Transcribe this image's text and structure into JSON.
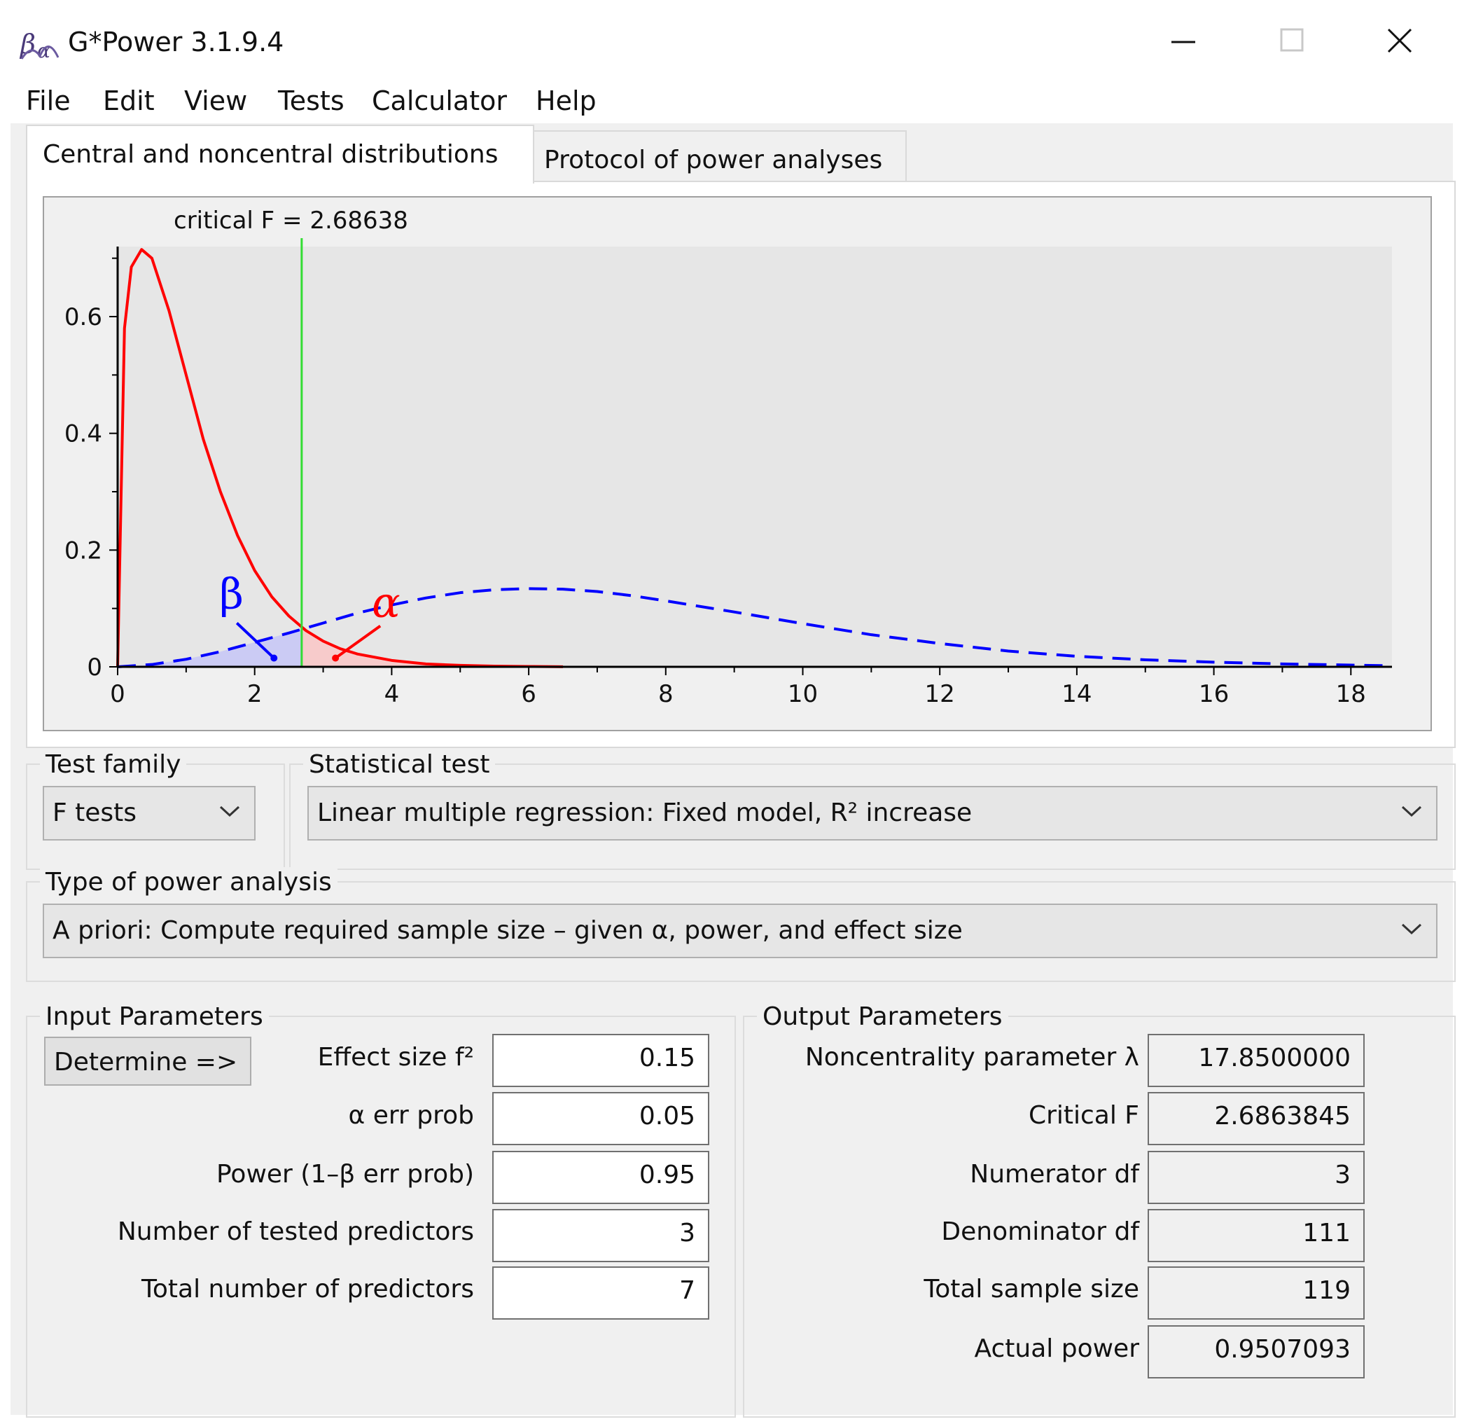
{
  "window": {
    "title": "G*Power 3.1.9.4"
  },
  "menu": [
    "File",
    "Edit",
    "View",
    "Tests",
    "Calculator",
    "Help"
  ],
  "tabs": [
    {
      "label": "Central and noncentral distributions",
      "active": true
    },
    {
      "label": "Protocol of power analyses",
      "active": false
    }
  ],
  "chart_data": {
    "type": "line",
    "annotation": "critical F = 2.68638",
    "critical_f": 2.68638,
    "xlim": [
      0,
      18.6
    ],
    "ylim": [
      0,
      0.72
    ],
    "x_ticks": [
      0,
      2,
      4,
      6,
      8,
      10,
      12,
      14,
      16,
      18
    ],
    "y_ticks": [
      0,
      0.2,
      0.4,
      0.6
    ],
    "y_tick_labels": [
      "0",
      "0.2",
      "0.4",
      "0.6"
    ],
    "series": [
      {
        "color": "#ff0000",
        "style": "solid",
        "x": [
          0,
          0.1,
          0.2,
          0.35,
          0.5,
          0.75,
          1.0,
          1.25,
          1.5,
          1.75,
          2.0,
          2.25,
          2.5,
          2.75,
          3.0,
          3.25,
          3.5,
          4.0,
          4.5,
          5.0,
          5.5,
          6.0,
          6.5
        ],
        "y": [
          0,
          0.58,
          0.685,
          0.715,
          0.7,
          0.61,
          0.5,
          0.39,
          0.3,
          0.225,
          0.165,
          0.12,
          0.087,
          0.062,
          0.044,
          0.031,
          0.022,
          0.011,
          0.005,
          0.0025,
          0.0012,
          0.0006,
          0.0002
        ]
      },
      {
        "color": "#0000ff",
        "style": "dashed",
        "x": [
          0,
          0.5,
          1.0,
          1.5,
          2.0,
          2.5,
          3.0,
          3.5,
          4.0,
          4.5,
          5.0,
          5.5,
          6.0,
          6.5,
          7.0,
          7.5,
          8.0,
          9.0,
          10.0,
          11.0,
          12.0,
          13.0,
          14.0,
          15.0,
          16.0,
          17.0,
          18.0,
          18.5
        ],
        "y": [
          0,
          0.004,
          0.013,
          0.026,
          0.042,
          0.058,
          0.075,
          0.092,
          0.106,
          0.118,
          0.127,
          0.132,
          0.134,
          0.133,
          0.129,
          0.122,
          0.113,
          0.094,
          0.074,
          0.055,
          0.04,
          0.027,
          0.018,
          0.012,
          0.008,
          0.005,
          0.003,
          0.002
        ]
      }
    ],
    "annotations": [
      {
        "text": "β",
        "color": "#0000ff",
        "x": 2.2,
        "y": 0.015
      },
      {
        "text": "α",
        "color": "#ff0000",
        "x": 3.2,
        "y": 0.015
      }
    ]
  },
  "test_family": {
    "legend": "Test family",
    "value": "F tests"
  },
  "statistical_test": {
    "legend": "Statistical test",
    "value": "Linear multiple regression: Fixed model, R² increase"
  },
  "power_analysis": {
    "legend": "Type of power analysis",
    "value": "A priori: Compute required sample size – given α, power, and effect size"
  },
  "input": {
    "legend": "Input Parameters",
    "determine_label": "Determine =>",
    "rows": [
      {
        "label": "Effect size f²",
        "value": "0.15"
      },
      {
        "label": "α err prob",
        "value": "0.05"
      },
      {
        "label": "Power (1–β err prob)",
        "value": "0.95"
      },
      {
        "label": "Number of tested predictors",
        "value": "3"
      },
      {
        "label": "Total number of predictors",
        "value": "7"
      }
    ]
  },
  "output": {
    "legend": "Output Parameters",
    "rows": [
      {
        "label": "Noncentrality parameter λ",
        "value": "17.8500000"
      },
      {
        "label": "Critical F",
        "value": "2.6863845"
      },
      {
        "label": "Numerator df",
        "value": "3"
      },
      {
        "label": "Denominator df",
        "value": "111"
      },
      {
        "label": "Total sample size",
        "value": "119"
      },
      {
        "label": "Actual power",
        "value": "0.9507093"
      }
    ]
  }
}
